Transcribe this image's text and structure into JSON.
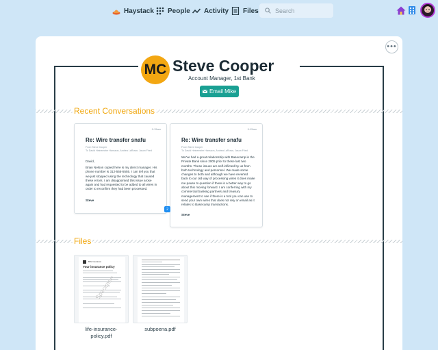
{
  "nav": {
    "items": [
      {
        "label": "Haystack",
        "icon": "haystack-icon"
      },
      {
        "label": "People",
        "icon": "people-icon"
      },
      {
        "label": "Activity",
        "icon": "activity-icon"
      },
      {
        "label": "Files",
        "icon": "files-icon"
      }
    ],
    "search_placeholder": "Search"
  },
  "person": {
    "initials": "MC",
    "name": "Steve Cooper",
    "title": "Account Manager, 1st Bank",
    "email_button": "Email Mike"
  },
  "sections": {
    "conversations": "Recent Conversations",
    "files": "Files"
  },
  "conversations": [
    {
      "time": "9:15am",
      "subject": "Re: Wire transfer snafu",
      "meta": "From Steve Cooper\nTo David Heinemeier Hansson, Andrea LaRowe, Jason Fried",
      "greeting": "David,",
      "body": "Brian Nelson copied here is my direct manager. His phone number is 312-555-5555. I can tell you that we just stopped using the technology that caused these errors. I am disappointed this issue arose again and had requested to be added to all wires in order to reconfirm they had been processed.",
      "signature": "Steve"
    },
    {
      "time": "9:15am",
      "subject": "Re: Wire transfer snafu",
      "meta": "From Steve Cooper\nTo David Heinemeier Hansson, Andrea LaRowe, Jason Fried",
      "greeting": "",
      "body": "We've had a great relationship with Basecamp in the Private Bank since 2005 prior to these last two months. These issues are self-inflicted by us from both technology and personnel. We made some changes to both and although we have reverted back to our old way of processing wires it does make me pause to question if there is a better way to go about this moving forward. I am conferring with my commercial banking partners and treasury management to see if there is a tool you can use to send your own wires that does not rely on email as it relates to Basecamp transactions.",
      "signature": "Steve"
    }
  ],
  "conversation_badge": "2",
  "files": [
    {
      "name": "life-insurance-policy.pdf",
      "doc_title": "Your insurance policy",
      "doc_org": "BIG Insurance",
      "watermark": "Specimen"
    },
    {
      "name": "subpoena.pdf"
    }
  ],
  "colors": {
    "accent": "#f0a60c",
    "email_button": "#1aa093",
    "avatar": "#f3a712",
    "background": "#cfe6f7"
  }
}
